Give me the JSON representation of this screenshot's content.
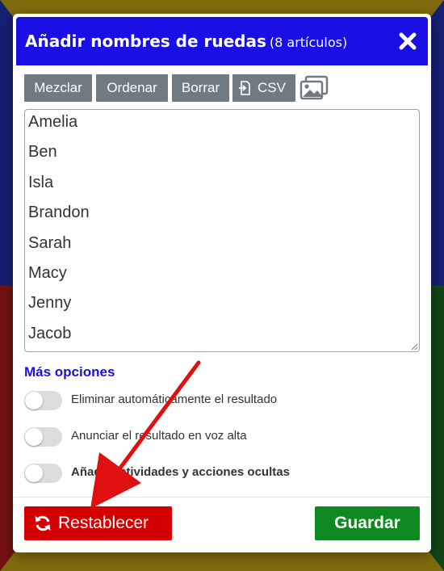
{
  "dialog": {
    "title": "Añadir nombres de ruedas",
    "count": "(8 artículos)",
    "close_icon": "close-x-icon"
  },
  "toolbar": {
    "shuffle_label": "Mezclar",
    "sort_label": "Ordenar",
    "clear_label": "Borrar",
    "csv_label": "CSV",
    "csv_icon": "file-import-icon",
    "image_icon": "image-gallery-icon"
  },
  "names": [
    "Amelia",
    "Ben",
    "Isla",
    "Brandon",
    "Sarah",
    "Macy",
    "Jenny",
    "Jacob"
  ],
  "options": {
    "heading": "Más opciones",
    "items": [
      {
        "label": "Eliminar automáticamente el resultado",
        "enabled": false
      },
      {
        "label": "Anunciar el resultado en voz alta",
        "enabled": false
      },
      {
        "label": "Añadir actividades y acciones ocultas",
        "enabled": false
      }
    ]
  },
  "footer": {
    "reset_label": "Restablecer",
    "reset_icon": "refresh-icon",
    "save_label": "Guardar"
  },
  "colors": {
    "header": "#1a10e6",
    "toolbar_button": "#707a82",
    "reset": "#d40000",
    "save": "#0f8a23",
    "annotation_arrow": "#e01010"
  }
}
